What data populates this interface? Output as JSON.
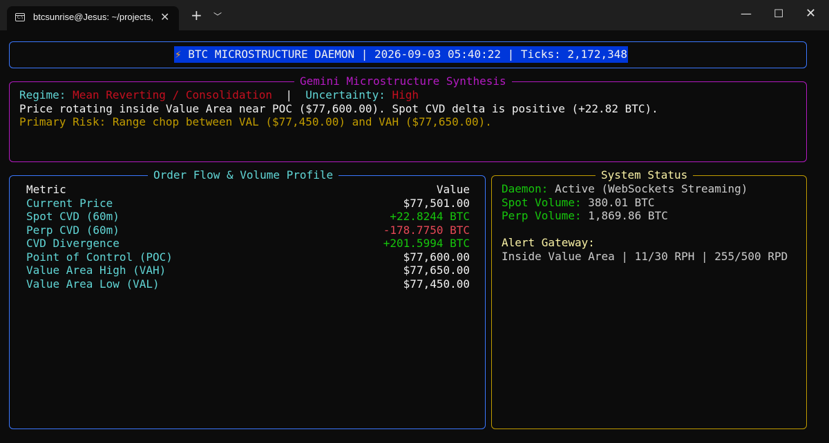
{
  "window": {
    "tab_title": "btcsunrise@Jesus: ~/projects,",
    "tab_icon": "terminal-icon",
    "icon_text": "C:\\"
  },
  "header": {
    "bolt": "⚡",
    "text": "BTC MICROSTRUCTURE DAEMON | 2026-09-03 05:40:22 | Ticks: 2,172,348"
  },
  "gemini": {
    "title": "Gemini Microstructure Synthesis",
    "regime_label": "Regime:",
    "regime_value": "Mean Reverting / Consolidation",
    "separator": "|",
    "uncertainty_label": "Uncertainty:",
    "uncertainty_value": "High",
    "summary": "Price rotating inside Value Area near POC ($77,600.00). Spot CVD delta is positive (+22.82 BTC).",
    "risk": "Primary Risk: Range chop between VAL ($77,450.00) and VAH ($77,650.00)."
  },
  "order_flow": {
    "title": "Order Flow & Volume Profile",
    "columns": [
      "Metric",
      "Value"
    ],
    "rows": [
      {
        "metric": "Current Price",
        "value": "$77,501.00",
        "color": "#f2f2f2"
      },
      {
        "metric": "Spot CVD (60m)",
        "value": "+22.8244 BTC",
        "color": "#16c60c"
      },
      {
        "metric": "Perp CVD (60m)",
        "value": "-178.7750 BTC",
        "color": "#e74856"
      },
      {
        "metric": "CVD Divergence",
        "value": "+201.5994 BTC",
        "color": "#16c60c"
      },
      {
        "metric": "Point of Control (POC)",
        "value": "$77,600.00",
        "color": "#f2f2f2"
      },
      {
        "metric": "Value Area High (VAH)",
        "value": "$77,650.00",
        "color": "#f2f2f2"
      },
      {
        "metric": "Value Area Low (VAL)",
        "value": "$77,450.00",
        "color": "#f2f2f2"
      }
    ]
  },
  "system_status": {
    "title": "System Status",
    "daemon_label": "Daemon:",
    "daemon_value": "Active (WebSockets Streaming)",
    "spot_label": "Spot Volume:",
    "spot_value": "380.01 BTC",
    "perp_label": "Perp Volume:",
    "perp_value": "1,869.86 BTC",
    "alert_label": "Alert Gateway:",
    "alert_value": "Inside Value Area | 11/30 RPH | 255/500 RPD"
  },
  "colors": {
    "blue_border": "#3b78ff",
    "magenta_border": "#b41ac2",
    "yellow_border": "#c19c00",
    "header_bg": "#0037da"
  }
}
